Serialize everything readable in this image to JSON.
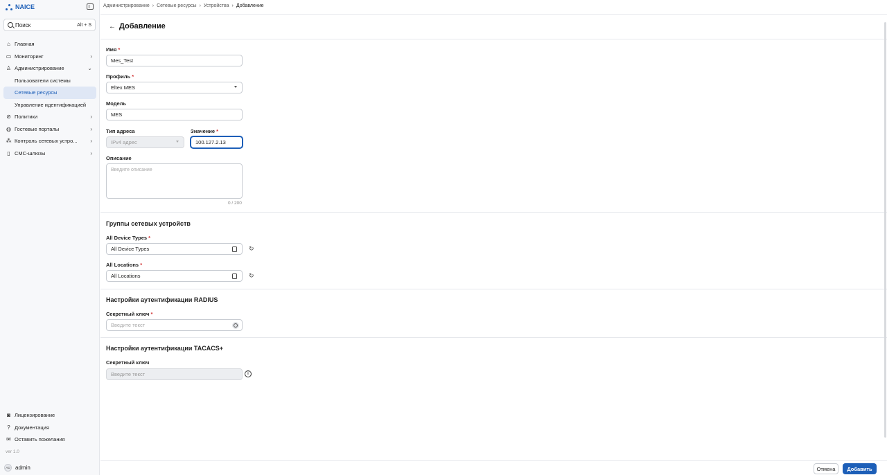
{
  "app": {
    "brand": "NAICE"
  },
  "search": {
    "label": "Поиск",
    "shortcut": "Alt + S"
  },
  "sidebar": {
    "items": [
      {
        "label": "Главная",
        "icon": "home-icon",
        "has_chevron": false
      },
      {
        "label": "Мониторинг",
        "icon": "monitor-icon",
        "has_chevron": true
      },
      {
        "label": "Администрирование",
        "icon": "users-icon",
        "has_chevron": true,
        "expanded": true
      },
      {
        "label": "Пользователи системы",
        "sub": true
      },
      {
        "label": "Сетевые ресурсы",
        "sub": true,
        "active": true
      },
      {
        "label": "Управление идентификацией",
        "sub": true
      },
      {
        "label": "Политики",
        "icon": "policy-icon",
        "has_chevron": true
      },
      {
        "label": "Гостевые порталы",
        "icon": "wifi-icon",
        "has_chevron": true
      },
      {
        "label": "Контроль сетевых устро...",
        "icon": "network-icon",
        "has_chevron": true
      },
      {
        "label": "СМС-шлюзы",
        "icon": "phone-icon",
        "has_chevron": true
      }
    ],
    "bottom": [
      {
        "label": "Лицензирование",
        "icon": "license-icon"
      },
      {
        "label": "Документация",
        "icon": "help-icon"
      },
      {
        "label": "Оставить пожелания",
        "icon": "mail-icon"
      }
    ],
    "version": "ver 1.0",
    "user": {
      "initials": "AD",
      "name": "admin"
    }
  },
  "breadcrumb": [
    "Администрирование",
    "Сетевые ресурсы",
    "Устройства",
    "Добавление"
  ],
  "header": {
    "title": "Добавление"
  },
  "form": {
    "name": {
      "label": "Имя",
      "value": "Mes_Test"
    },
    "profile": {
      "label": "Профиль",
      "value": "Eltex MES"
    },
    "model": {
      "label": "Модель",
      "value": "MES"
    },
    "address_type": {
      "label": "Тип адреса",
      "value": "IPv4 адрес"
    },
    "address_value": {
      "label": "Значение",
      "value": "100.127.2.13"
    },
    "description": {
      "label": "Описание",
      "placeholder": "Введите описание",
      "counter": "0 / 200"
    }
  },
  "groups": {
    "title": "Группы сетевых устройств",
    "device_types": {
      "label": "All Device Types",
      "value": "All Device Types"
    },
    "locations": {
      "label": "All Locations",
      "value": "All Locations"
    }
  },
  "radius": {
    "title": "Настройки аутентификации RADIUS",
    "secret": {
      "label": "Секретный ключ",
      "placeholder": "Введите текст"
    }
  },
  "tacacs": {
    "title": "Настройки аутентификации TACACS+",
    "secret": {
      "label": "Секретный ключ",
      "placeholder": "Введите текст"
    }
  },
  "footer": {
    "cancel": "Отмена",
    "add": "Добавить"
  },
  "colors": {
    "accent": "#1d5fb8",
    "required": "#d13030"
  }
}
